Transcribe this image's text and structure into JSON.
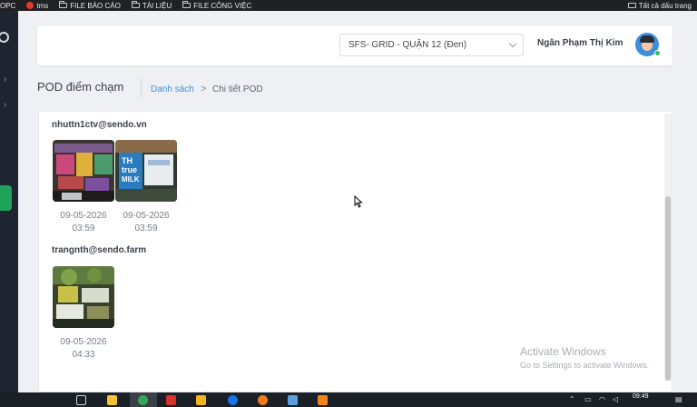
{
  "bookmarks": {
    "items": [
      {
        "label": "OPC"
      },
      {
        "label": "tms"
      },
      {
        "label": "FILE BÁO CÁO"
      },
      {
        "label": "TÀI LIỆU"
      },
      {
        "label": "FILE CÔNG VIỆC"
      }
    ],
    "all_bookmarks": "Tất cả dấu trang"
  },
  "header": {
    "store_select": "SFS- GRID - QUẬN 12 (Đen)",
    "user_name": "Ngân Phạm Thị Kim"
  },
  "page": {
    "title": "POD điểm chạm",
    "breadcrumb_link": "Danh sách",
    "breadcrumb_sep": ">",
    "breadcrumb_current": "Chi tiết POD"
  },
  "groups": [
    {
      "email": "nhuttn1ctv@sendo.vn",
      "photos": [
        {
          "date": "09-05-2026",
          "time": "03:59"
        },
        {
          "date": "09-05-2026",
          "time": "03:59"
        }
      ]
    },
    {
      "email": "trangnth@sendo.farm",
      "photos": [
        {
          "date": "09-05-2026",
          "time": "04:33"
        }
      ]
    }
  ],
  "photo_labels": {
    "milk_brand_1": "TH",
    "milk_brand_2": "true",
    "milk_brand_3": "MILK"
  },
  "watermark": {
    "line1": "Activate Windows",
    "line2": "Go to Settings to activate Windows."
  },
  "taskbar": {
    "time": "09:49"
  }
}
